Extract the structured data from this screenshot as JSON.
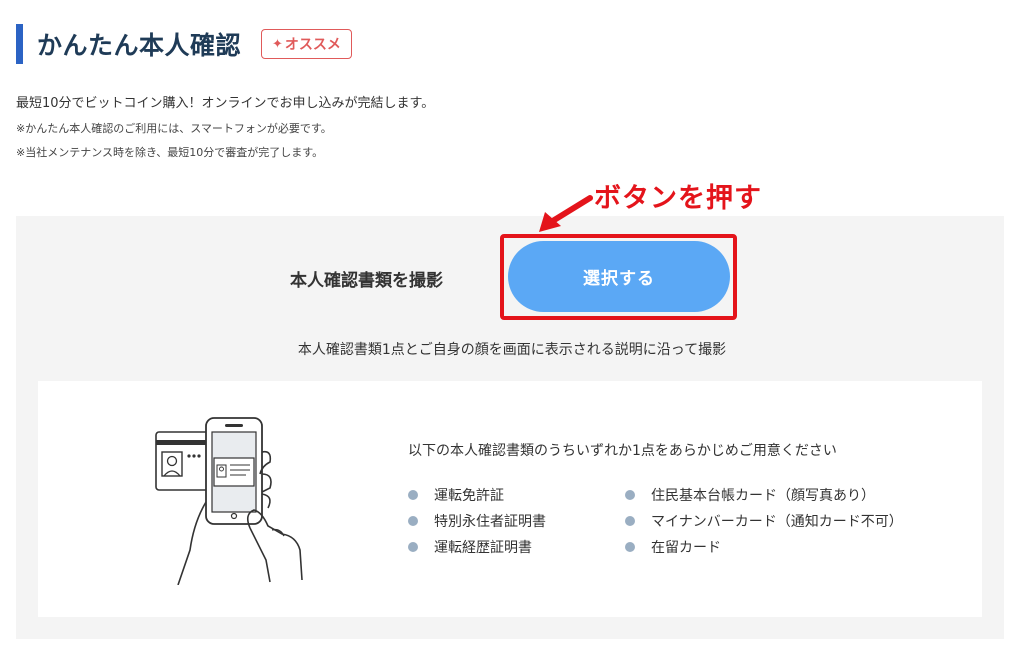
{
  "header": {
    "title": "かんたん本人確認",
    "badge_icon": "sparkle-icon",
    "badge_label": "オススメ"
  },
  "intro": {
    "main": "最短10分でビットコイン購入！オンラインでお申し込みが完結します。",
    "notes": [
      "※かんたん本人確認のご利用には、スマートフォンが必要です。",
      "※当社メンテナンス時を除き、最短10分で審査が完了します。"
    ]
  },
  "annotation": {
    "text": "ボタンを押す",
    "color": "#e4141b"
  },
  "capture": {
    "label": "本人確認書類を撮影",
    "button_label": "選択する",
    "button_color": "#5ba8f5",
    "instruction": "本人確認書類1点とご自身の顔を画面に表示される説明に沿って撮影"
  },
  "documents": {
    "heading": "以下の本人確認書類のうちいずれか1点をあらかじめご用意ください",
    "column1": [
      "運転免許証",
      "特別永住者証明書",
      "運転経歴証明書"
    ],
    "column2": [
      "住民基本台帳カード（顔写真あり）",
      "マイナンバーカード（通知カード不可）",
      "在留カード"
    ]
  },
  "colors": {
    "accent_blue": "#2b63c4",
    "title_navy": "#1f3b57",
    "badge_red": "#e05a5a",
    "panel_gray": "#f4f4f4",
    "bullet": "#9aaec2"
  }
}
